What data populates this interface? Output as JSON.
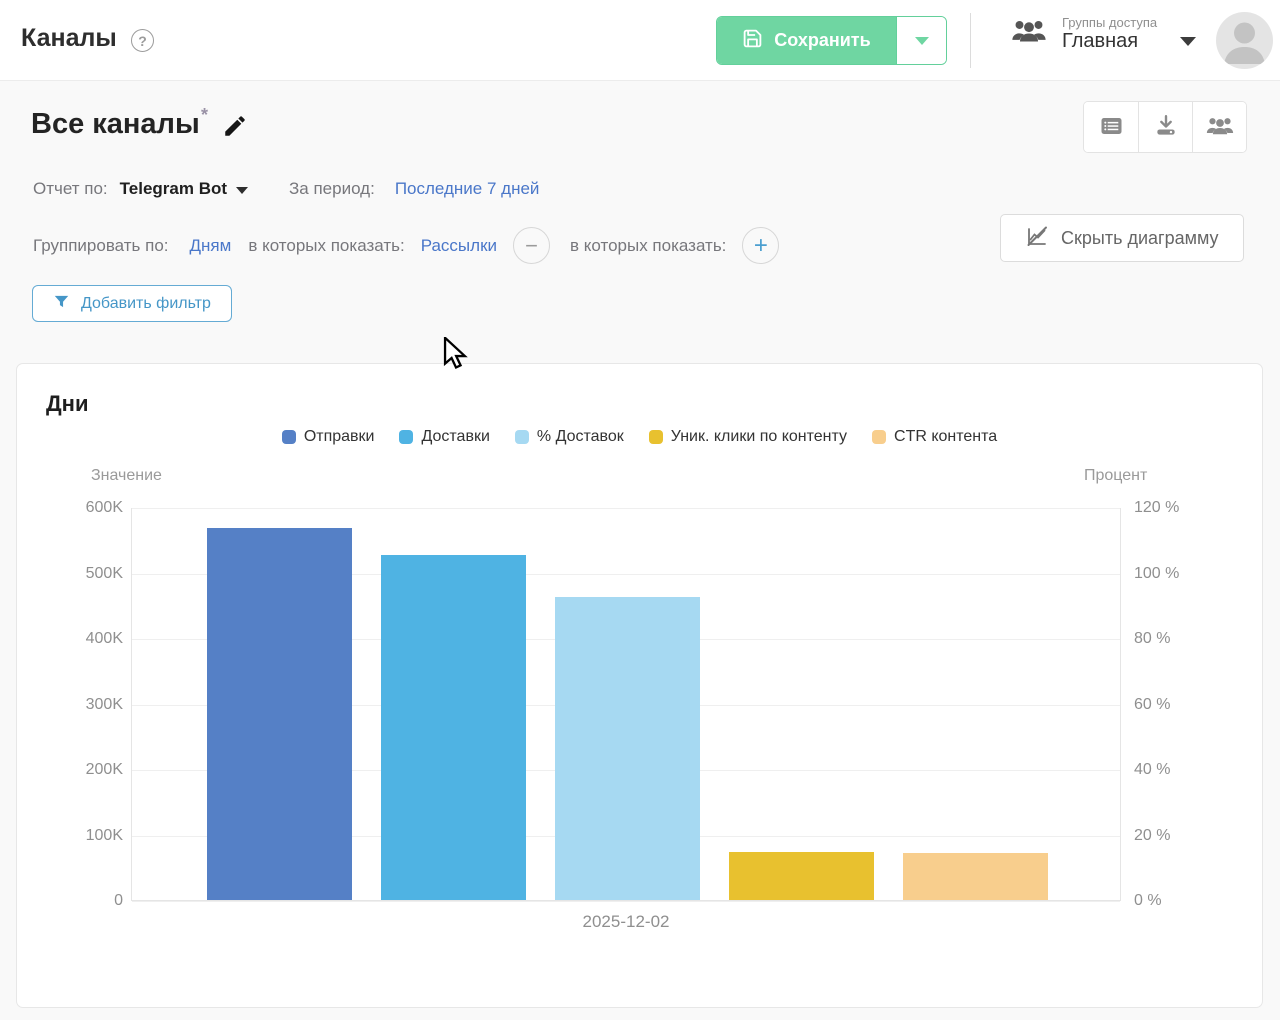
{
  "header": {
    "title": "Каналы",
    "help_icon": "?",
    "save_label": "Сохранить",
    "access_group_label": "Группы доступа",
    "access_group_value": "Главная"
  },
  "report": {
    "title": "Все каналы",
    "title_mark": "*",
    "report_by_label": "Отчет по:",
    "report_by_value": "Telegram Bot",
    "period_label": "За период:",
    "period_value": "Последние 7 дней",
    "group_by_label": "Группировать по:",
    "group_by_value": "Дням",
    "show_in_label_1": "в которых показать:",
    "show_in_value_1": "Рассылки",
    "minus_glyph": "−",
    "show_in_label_2": "в которых показать:",
    "plus_glyph": "+",
    "hide_chart_label": "Скрыть диаграмму",
    "add_filter_label": "Добавить фильтр"
  },
  "chart_data": {
    "type": "bar",
    "title": "Дни",
    "categories": [
      "2025-12-02"
    ],
    "left_axis": {
      "title": "Значение",
      "max": 600000,
      "ticks": [
        "600K",
        "500K",
        "400K",
        "300K",
        "200K",
        "100K",
        "0"
      ]
    },
    "right_axis": {
      "title": "Процент",
      "max": 120,
      "ticks": [
        "120 %",
        "100 %",
        "80 %",
        "60 %",
        "40 %",
        "20 %",
        "0 %"
      ]
    },
    "series": [
      {
        "name": "Отправки",
        "axis": "left",
        "values": [
          568000
        ],
        "color": "#5580c6"
      },
      {
        "name": "Доставки",
        "axis": "left",
        "values": [
          527000
        ],
        "color": "#4fb3e3"
      },
      {
        "name": "% Доставок",
        "axis": "right",
        "values": [
          92.5
        ],
        "color": "#a6d9f2"
      },
      {
        "name": "Уник. клики по контенту",
        "axis": "left",
        "values": [
          73000
        ],
        "color": "#e8c12f"
      },
      {
        "name": "CTR контента",
        "axis": "right",
        "values": [
          14.4
        ],
        "color": "#f8ce8d"
      }
    ],
    "grid": true,
    "legend_position": "top"
  },
  "colors": {
    "accent_green": "#6fd6a2",
    "link_blue": "#4a77c9",
    "filter_blue": "#4596c7"
  }
}
